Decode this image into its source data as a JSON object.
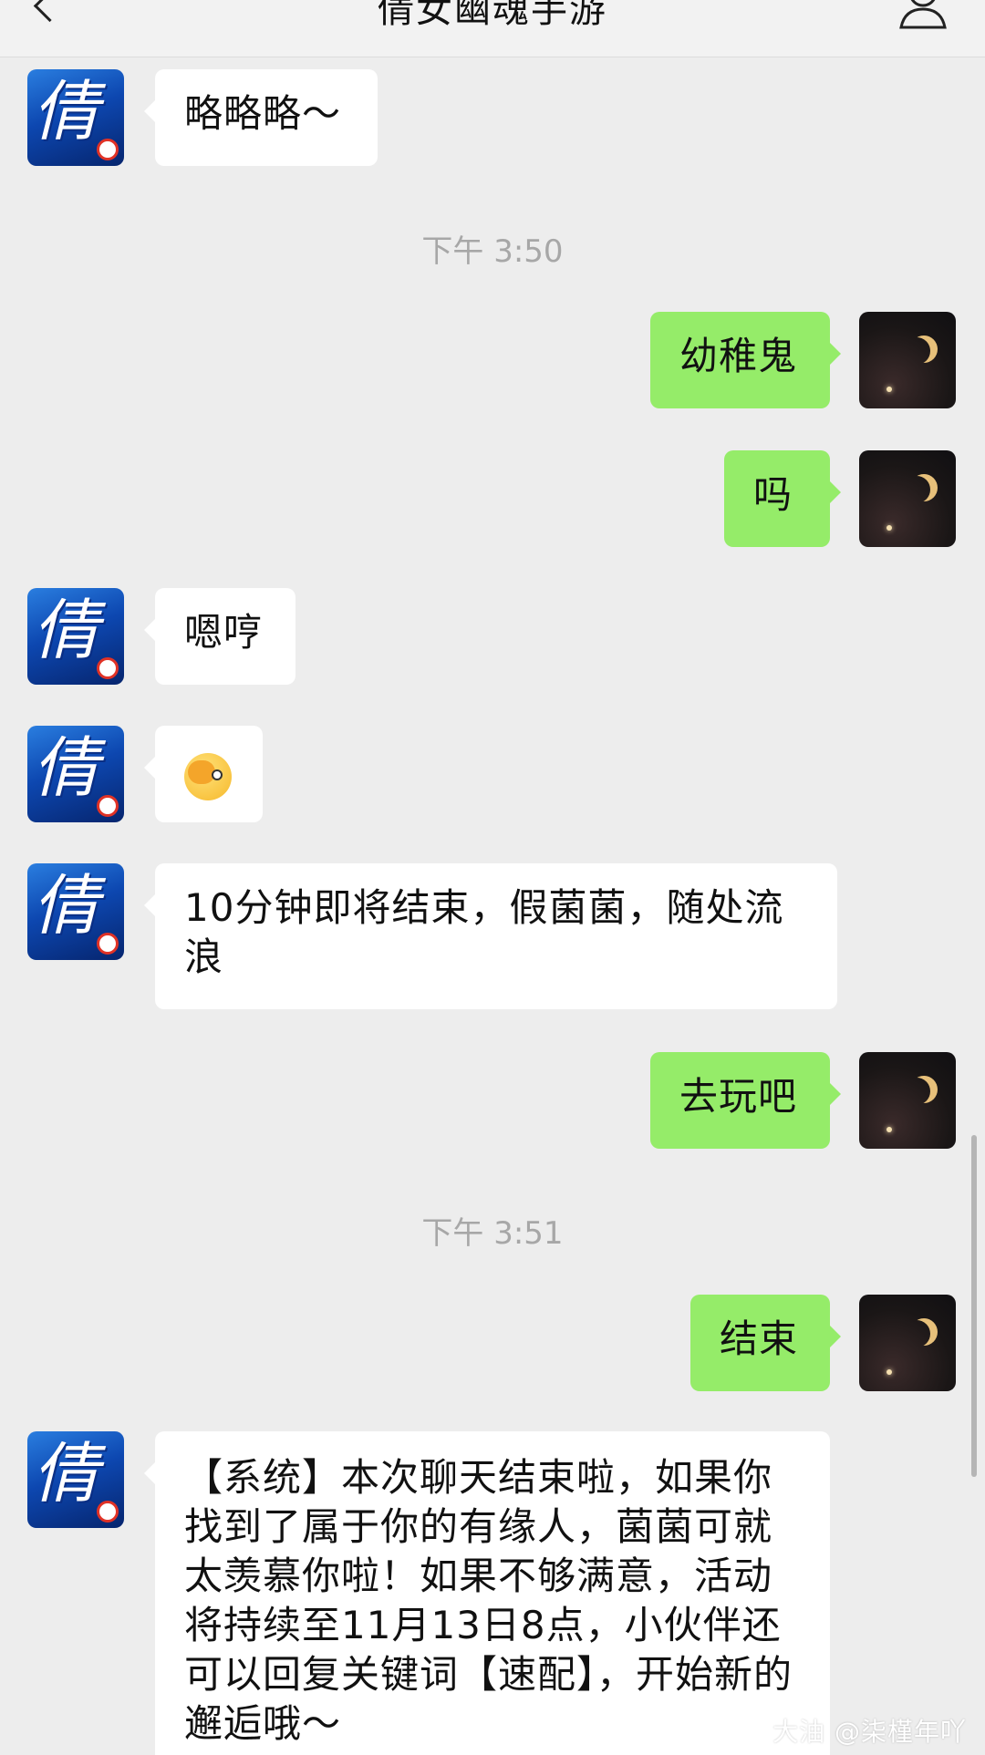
{
  "header": {
    "title": "倩女幽魂手游",
    "back_icon": "chevron-left-icon",
    "profile_icon": "person-icon"
  },
  "avatars": {
    "game": {
      "glyph": "倩",
      "icon": "game-logo-avatar"
    },
    "me": {
      "icon": "crescent-moon-avatar"
    }
  },
  "messages": [
    {
      "side": "in",
      "text": "略略略～"
    },
    {
      "type": "time",
      "text": "下午 3:50"
    },
    {
      "side": "out",
      "text": "幼稚鬼"
    },
    {
      "side": "out",
      "text": "吗"
    },
    {
      "side": "in",
      "text": "嗯哼"
    },
    {
      "side": "in",
      "emoji": "face-with-hand-over-eye-emoji"
    },
    {
      "side": "in",
      "text": "10分钟即将结束，假菌菌，随处流浪"
    },
    {
      "side": "out",
      "text": "去玩吧"
    },
    {
      "type": "time",
      "text": "下午 3:51"
    },
    {
      "side": "out",
      "text": "结束"
    },
    {
      "side": "in",
      "text": "【系统】本次聊天结束啦，如果你找到了属于你的有缘人，菌菌可就太羡慕你啦！如果不够满意，活动将持续至11月13日8点，小伙伴还可以回复关键词【速配】，开始新的邂逅哦～"
    }
  ],
  "watermark": "大油 @柒槿年吖",
  "colors": {
    "background": "#ededed",
    "incoming_bubble": "#ffffff",
    "outgoing_bubble": "#95ec69",
    "timestamp": "#a7a7a7"
  }
}
